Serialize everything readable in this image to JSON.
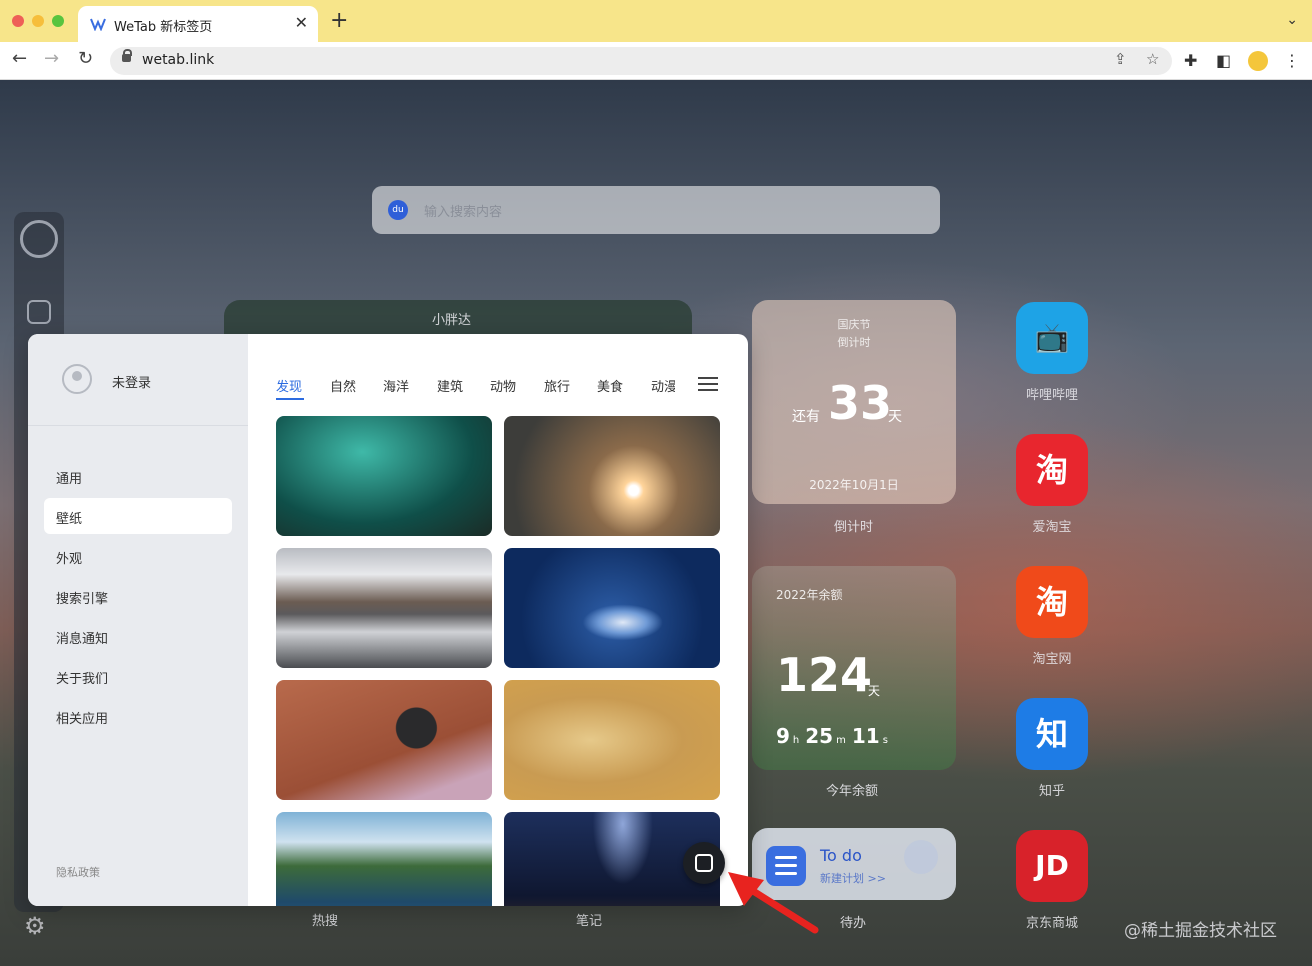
{
  "browser": {
    "tab_title": "WeTab 新标签页",
    "tab_close": "✕",
    "new_tab": "+",
    "url": "wetab.link"
  },
  "page": {
    "search_placeholder": "输入搜索内容",
    "search_engine_icon": "baidu-icon",
    "widget_bg_label": "小胖达",
    "countdown": {
      "title_line1": "国庆节",
      "title_line2": "倒计时",
      "prefix": "还有",
      "days": "33",
      "suffix": "天",
      "date": "2022年10月1日",
      "label": "倒计时"
    },
    "year_left": {
      "title": "2022年余额",
      "days": "124",
      "days_unit": "天",
      "hours": "9",
      "hours_unit": "h",
      "minutes": "25",
      "minutes_unit": "m",
      "seconds": "11",
      "seconds_unit": "s",
      "label": "今年余额"
    },
    "todo": {
      "title": "To do",
      "subtitle": "新建计划 >>",
      "label": "待办"
    },
    "apps": [
      {
        "name": "哔哩哔哩",
        "glyph": "📺",
        "color": "#1ea3e6"
      },
      {
        "name": "爱淘宝",
        "glyph": "淘",
        "color": "#e8262e"
      },
      {
        "name": "淘宝网",
        "glyph": "淘",
        "color": "#f04a1a"
      },
      {
        "name": "知乎",
        "glyph": "知",
        "color": "#1e7ce6"
      },
      {
        "name": "京东商城",
        "glyph": "JD",
        "color": "#d8222a"
      }
    ],
    "dock_labels": [
      "热搜",
      "笔记"
    ],
    "watermark": "@稀土掘金技术社区"
  },
  "settings": {
    "user_name": "未登录",
    "menu": [
      "通用",
      "壁纸",
      "外观",
      "搜索引擎",
      "消息通知",
      "关于我们",
      "相关应用"
    ],
    "active_menu": "壁纸",
    "privacy": "隐私政策",
    "categories": [
      "发现",
      "自然",
      "海洋",
      "建筑",
      "动物",
      "旅行",
      "美食",
      "动漫"
    ],
    "active_category": "发现"
  },
  "colors": {
    "accent": "#2c6be0",
    "tabbar": "#f7e58a"
  }
}
